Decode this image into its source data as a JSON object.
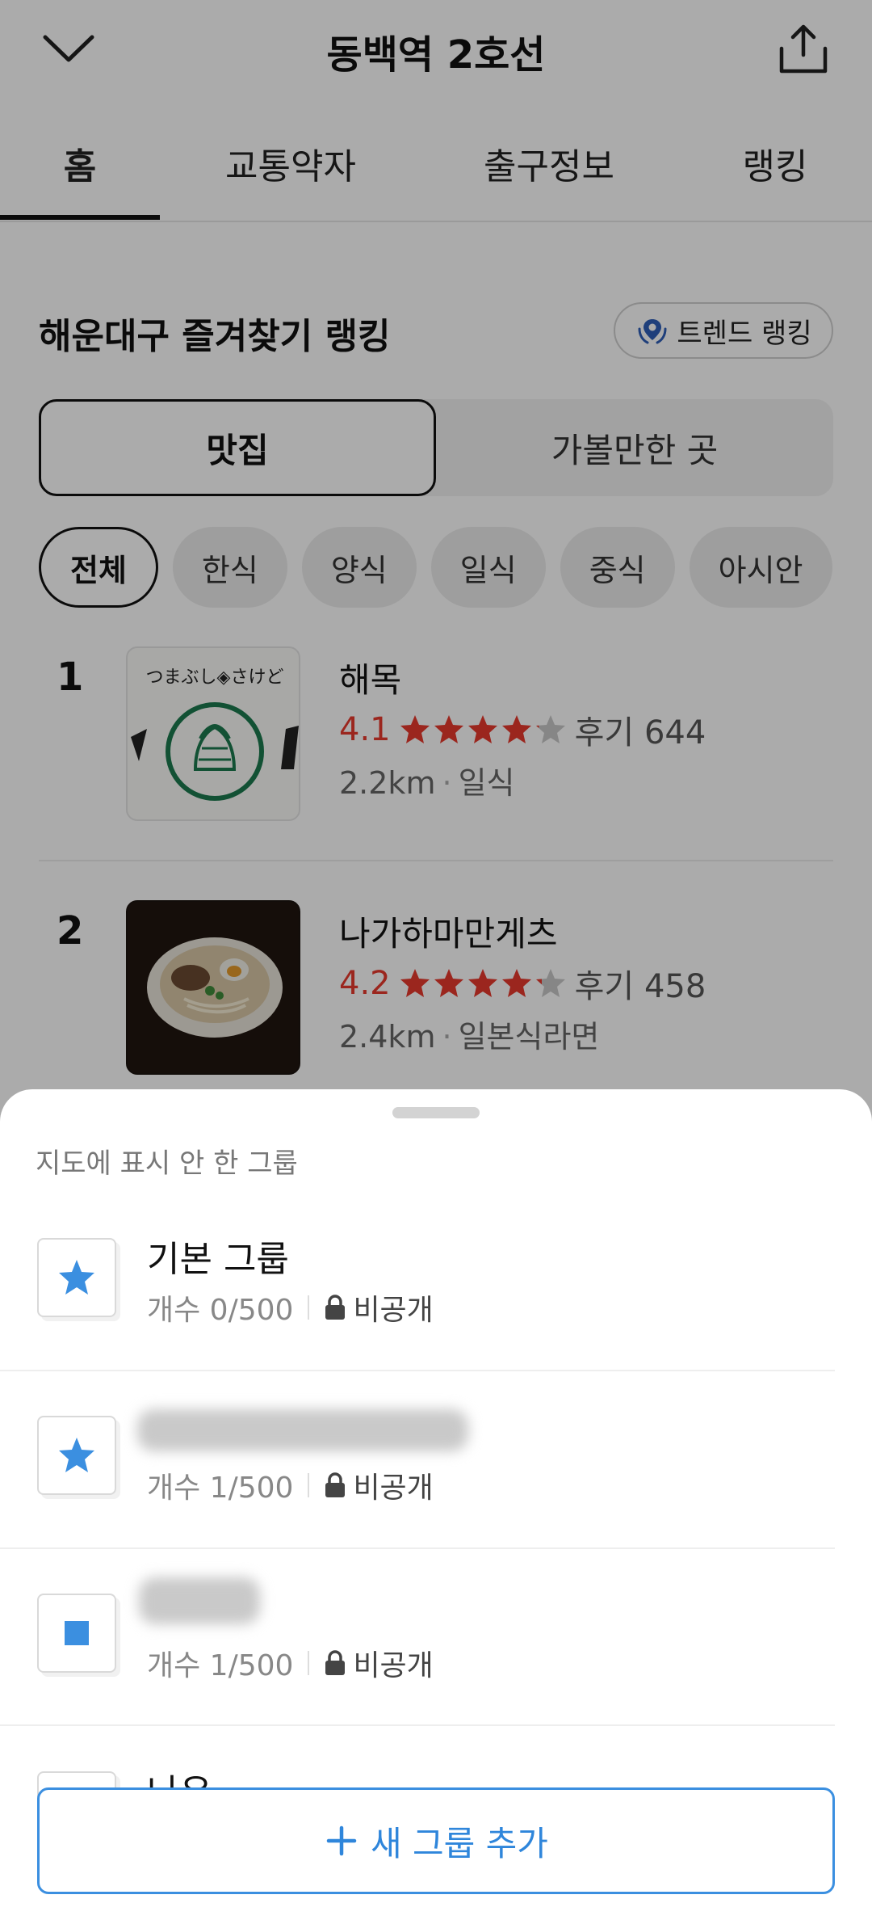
{
  "header": {
    "title": "동백역 2호선"
  },
  "tabs": [
    "홈",
    "교통약자",
    "출구정보",
    "랭킹"
  ],
  "ranking": {
    "title": "해운대구 즐겨찾기 랭킹",
    "trend_button": "트렌드 랭킹",
    "segments": [
      "맛집",
      "가볼만한 곳"
    ],
    "chips": [
      "전체",
      "한식",
      "양식",
      "일식",
      "중식",
      "아시안"
    ],
    "items": [
      {
        "rank": "1",
        "name": "해목",
        "rating": "4.1",
        "reviews": "후기 644",
        "distance": "2.2km",
        "category": "일식",
        "thumb_text": "つまぶし◈さけど",
        "stars": [
          1,
          1,
          1,
          1,
          0.1
        ]
      },
      {
        "rank": "2",
        "name": "나가하마만게츠",
        "rating": "4.2",
        "reviews": "후기 458",
        "distance": "2.4km",
        "category": "일본식라면",
        "stars": [
          1,
          1,
          1,
          1,
          0.2
        ]
      }
    ]
  },
  "sheet": {
    "label": "지도에 표시 안 한 그룹",
    "groups": [
      {
        "name": "기본 그룹",
        "count": "개수 0/500",
        "privacy": "비공개",
        "icon": "star-icon",
        "color": "#3b8fe0"
      },
      {
        "name": "",
        "count": "개수 1/500",
        "privacy": "비공개",
        "icon": "star-icon",
        "color": "#3b8fe0"
      },
      {
        "name": "",
        "count": "개수 1/500",
        "privacy": "비공개",
        "icon": "square-icon",
        "color": "#3b8fe0"
      },
      {
        "name": "나우",
        "count": "",
        "privacy": "",
        "icon": "",
        "color": ""
      }
    ],
    "add_button": "새 그룹 추가"
  },
  "colors": {
    "accent": "#3b8fe0",
    "rating": "#e83a2e"
  }
}
